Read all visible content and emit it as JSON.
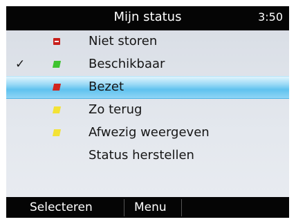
{
  "header": {
    "title": "Mijn status",
    "clock": "3:50"
  },
  "status_list": {
    "items": [
      {
        "label": "Niet storen",
        "icon": "do-not-disturb-icon",
        "color": "#c8201c",
        "checked": false,
        "selected": false
      },
      {
        "label": "Beschikbaar",
        "icon": "available-icon",
        "color": "#3ec42f",
        "checked": true,
        "selected": false
      },
      {
        "label": "Bezet",
        "icon": "busy-icon",
        "color": "#d0271f",
        "checked": false,
        "selected": true
      },
      {
        "label": "Zo terug",
        "icon": "be-right-back-icon",
        "color": "#f3e235",
        "checked": false,
        "selected": false
      },
      {
        "label": "Afwezig weergeven",
        "icon": "appear-away-icon",
        "color": "#f3e235",
        "checked": false,
        "selected": false
      },
      {
        "label": "Status herstellen",
        "icon": null,
        "checked": false,
        "selected": false
      }
    ],
    "check_glyph": "✓",
    "selection_color": "#60c2ef"
  },
  "softkeys": {
    "left": "Selecteren",
    "middle": "Menu"
  }
}
